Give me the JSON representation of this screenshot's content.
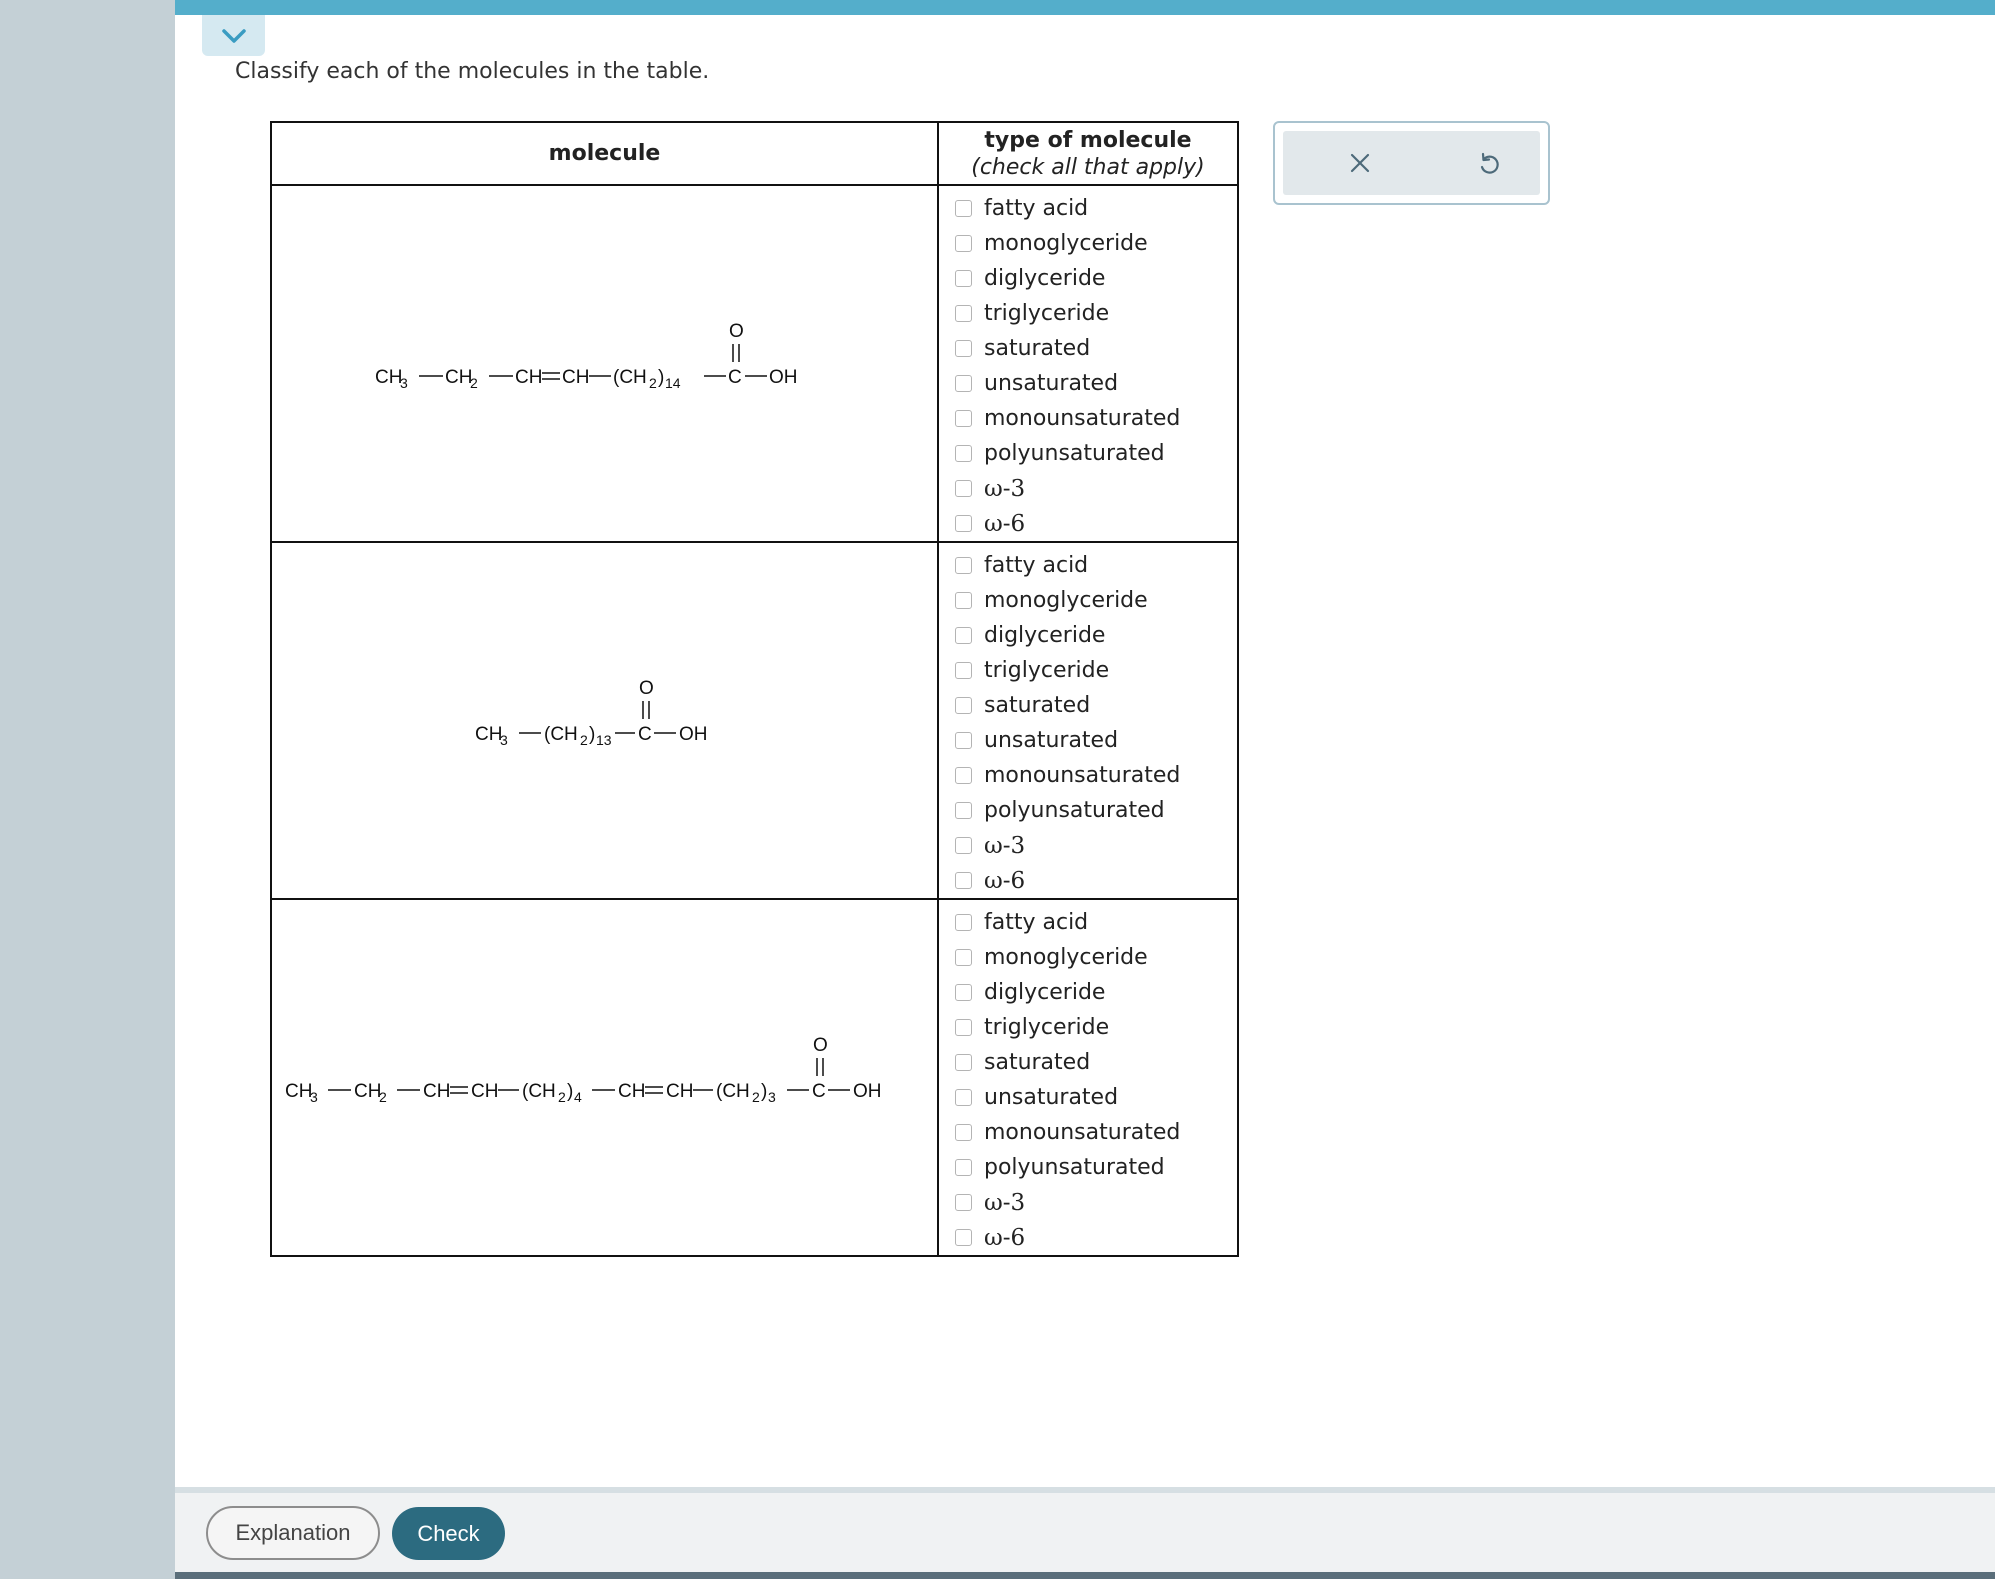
{
  "instructions": "Classify each of the molecules in the table.",
  "table": {
    "col_molecule": "molecule",
    "col_type_title": "type of molecule",
    "col_type_subtitle": "(check all that apply)",
    "options": [
      "fatty acid",
      "monoglyceride",
      "diglyceride",
      "triglyceride",
      "saturated",
      "unsaturated",
      "monounsaturated",
      "polyunsaturated",
      "ω-3",
      "ω-6"
    ],
    "rows": [
      {
        "molecule": "CH3—CH2—CH=CH—(CH2)14—C(=O)—OH",
        "parts": {
          "a": "CH",
          "b": "3",
          "c": "CH",
          "d": "2",
          "e": "CH",
          "f": "CH",
          "g": "(CH",
          "h": "2",
          "i": ")",
          "j": "14",
          "k": "C",
          "l": "OH",
          "o": "O"
        }
      },
      {
        "molecule": "CH3—(CH2)13—C(=O)—OH",
        "parts": {
          "a": "CH",
          "b": "3",
          "c": "(CH",
          "d": "2",
          "e": ")",
          "f": "13",
          "g": "C",
          "h": "OH",
          "o": "O"
        }
      },
      {
        "molecule": "CH3—CH2—CH=CH—(CH2)4—CH=CH—(CH2)3—C(=O)—OH",
        "parts": {
          "a": "CH",
          "b": "3",
          "c": "CH",
          "d": "2",
          "e": "CH",
          "f": "CH",
          "g": "(CH",
          "h": "2",
          "i": ")",
          "j": "4",
          "k": "CH",
          "l": "CH",
          "m": "(CH",
          "n": "2",
          "p": ")",
          "q": "3",
          "r": "C",
          "s": "OH",
          "o": "O"
        }
      }
    ]
  },
  "tools": {
    "clear_icon": "close-icon",
    "undo_icon": "undo-icon"
  },
  "buttons": {
    "explanation": "Explanation",
    "check": "Check"
  },
  "colors": {
    "accent": "#54aecb",
    "check_button": "#2c6b80",
    "rail": "#c4d0d6"
  }
}
